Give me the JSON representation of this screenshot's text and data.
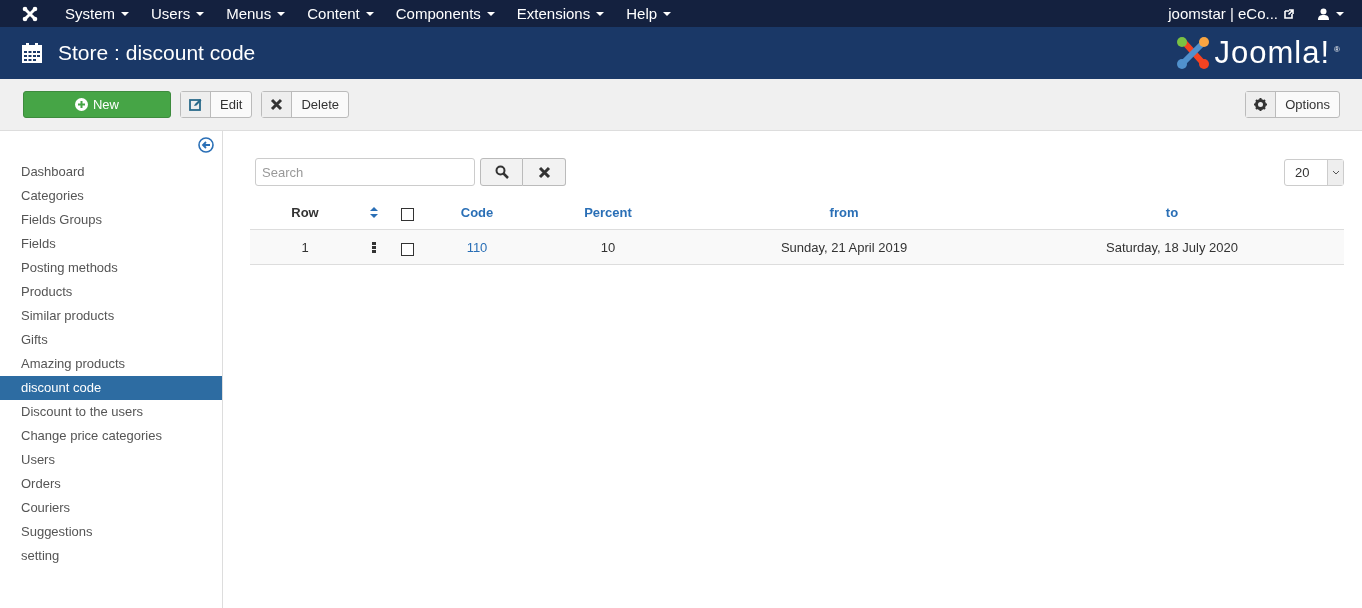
{
  "top_menu": [
    {
      "label": "System"
    },
    {
      "label": "Users"
    },
    {
      "label": "Menus"
    },
    {
      "label": "Content"
    },
    {
      "label": "Components"
    },
    {
      "label": "Extensions"
    },
    {
      "label": "Help"
    }
  ],
  "site_link": "joomstar | eCo...",
  "header": {
    "title": "Store : discount code",
    "logo_text": "Joomla!",
    "logo_mark": "®"
  },
  "toolbar": [
    {
      "kind": "new",
      "label": "New"
    },
    {
      "kind": "edit",
      "label": "Edit"
    },
    {
      "kind": "delete",
      "label": "Delete"
    }
  ],
  "options_button": "Options",
  "sidebar": {
    "items": [
      {
        "label": "Dashboard",
        "selected": false
      },
      {
        "label": "Categories",
        "selected": false
      },
      {
        "label": "Fields Groups",
        "selected": false
      },
      {
        "label": "Fields",
        "selected": false
      },
      {
        "label": "Posting methods",
        "selected": false
      },
      {
        "label": "Products",
        "selected": false
      },
      {
        "label": "Similar products",
        "selected": false
      },
      {
        "label": "Gifts",
        "selected": false
      },
      {
        "label": "Amazing products",
        "selected": false
      },
      {
        "label": "discount code",
        "selected": true
      },
      {
        "label": "Discount to the users",
        "selected": false
      },
      {
        "label": "Change price categories",
        "selected": false
      },
      {
        "label": "Users",
        "selected": false
      },
      {
        "label": "Orders",
        "selected": false
      },
      {
        "label": "Couriers",
        "selected": false
      },
      {
        "label": "Suggestions",
        "selected": false
      },
      {
        "label": "setting",
        "selected": false
      }
    ]
  },
  "search": {
    "placeholder": "Search"
  },
  "limit": "20",
  "table": {
    "columns": [
      {
        "kind": "text",
        "label": "Row"
      },
      {
        "kind": "sort"
      },
      {
        "kind": "check",
        "checked": false
      },
      {
        "kind": "link",
        "label": "Code"
      },
      {
        "kind": "link",
        "label": "Percent"
      },
      {
        "kind": "link",
        "label": "from"
      },
      {
        "kind": "link",
        "label": "to"
      }
    ],
    "rows": [
      {
        "checked": false,
        "row": "1",
        "code": "110",
        "percent": "10",
        "from": "Sunday, 21 April 2019",
        "to": "Saturday, 18 July 2020"
      }
    ]
  }
}
